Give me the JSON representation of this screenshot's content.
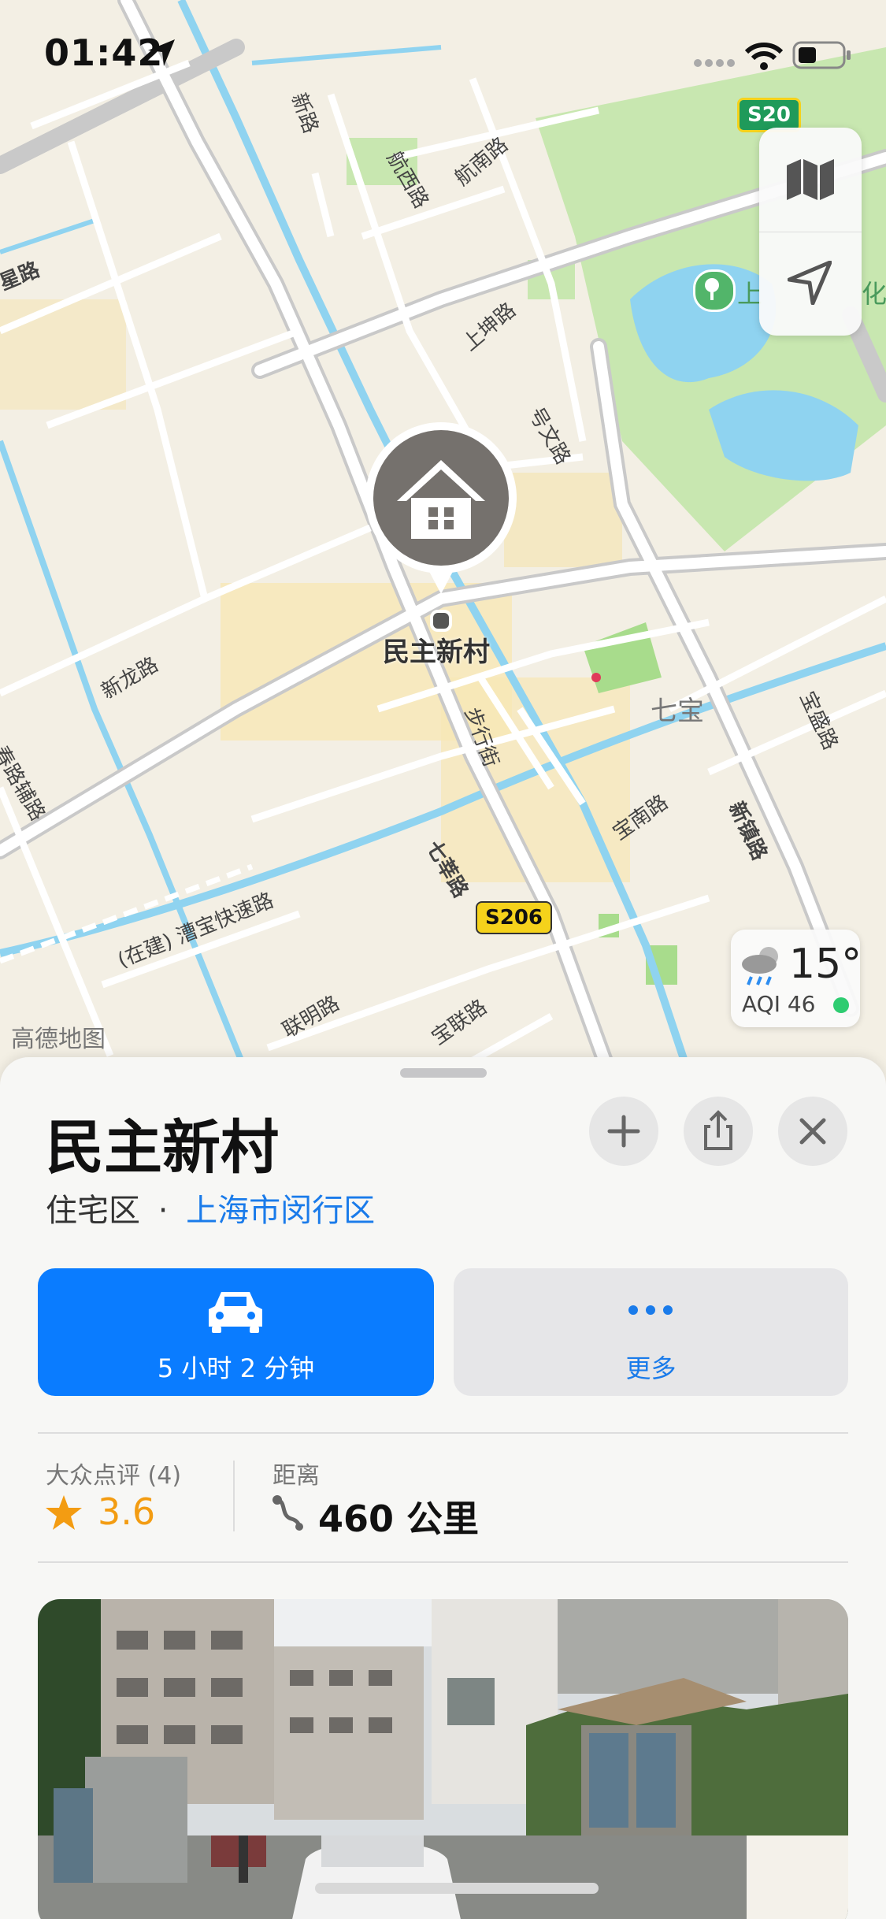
{
  "status_bar": {
    "time": "01:42"
  },
  "map": {
    "place_label": "民主新村",
    "district_label": "七宝",
    "watermark": "高德地图",
    "highway_shields": [
      "S20",
      "S206"
    ],
    "road_labels": {
      "xinlong": "新龙路",
      "buxing": "步行街",
      "qixin": "七莘路",
      "baonan": "宝南路",
      "xinzhen": "新镇路",
      "baosheng": "宝盛路",
      "caobao": "(在建) 漕宝快速路",
      "lianming": "联明路",
      "baolian": "宝联路",
      "hangxi": "航西路",
      "hangnan": "航南路",
      "shangkun": "上坤路",
      "haowen": "号文路",
      "xin_top": "新路",
      "star": "星路",
      "spring_aux": "春路辅路",
      "park_left": "上",
      "park_right": "化"
    }
  },
  "weather": {
    "temp": "15°",
    "aqi": "AQI 46"
  },
  "sheet": {
    "title": "民主新村",
    "category": "住宅区",
    "separator": "·",
    "region": "上海市闵行区",
    "drive_label": "5 小时 2 分钟",
    "more_label": "更多",
    "review_label": "大众点评 (4)",
    "rating": "3.6",
    "distance_label": "距离",
    "distance_value": "460 公里"
  },
  "icons": [
    "location-arrow-icon",
    "signal-icon",
    "wifi-icon",
    "battery-icon",
    "map-icon",
    "location-icon",
    "home-icon",
    "cloud-rain-icon",
    "add-icon",
    "share-icon",
    "close-icon",
    "car-icon",
    "more-icon",
    "star-icon",
    "route-icon"
  ],
  "colors": {
    "accent": "#0a7cff",
    "rating": "#f39c12",
    "aqi_good": "#2ecc71"
  }
}
